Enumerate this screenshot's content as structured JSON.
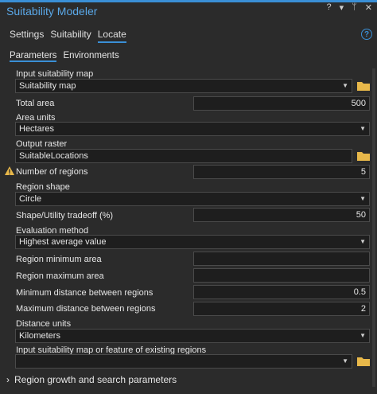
{
  "window": {
    "title": "Suitability Modeler",
    "controls": [
      "?",
      "▾",
      "ᛘ",
      "✕"
    ]
  },
  "tabs": [
    "Settings",
    "Suitability",
    "Locate"
  ],
  "subtabs": [
    "Parameters",
    "Environments"
  ],
  "help_symbol": "?",
  "params": {
    "input_suitability_map": {
      "label": "Input suitability map",
      "value": "Suitability map"
    },
    "total_area": {
      "label": "Total area",
      "value": "500"
    },
    "area_units": {
      "label": "Area units",
      "value": "Hectares"
    },
    "output_raster": {
      "label": "Output raster",
      "value": "SuitableLocations"
    },
    "number_of_regions": {
      "label": "Number of regions",
      "value": "5"
    },
    "region_shape": {
      "label": "Region shape",
      "value": "Circle"
    },
    "shape_tradeoff": {
      "label": "Shape/Utility tradeoff (%)",
      "value": "50"
    },
    "evaluation_method": {
      "label": "Evaluation method",
      "value": "Highest average value"
    },
    "region_min_area": {
      "label": "Region minimum area",
      "value": ""
    },
    "region_max_area": {
      "label": "Region maximum area",
      "value": ""
    },
    "min_distance": {
      "label": "Minimum distance between regions",
      "value": "0.5"
    },
    "max_distance": {
      "label": "Maximum distance between regions",
      "value": "2"
    },
    "distance_units": {
      "label": "Distance units",
      "value": "Kilometers"
    },
    "existing_regions": {
      "label": "Input suitability map or feature of existing regions",
      "value": ""
    }
  },
  "section": {
    "label": "Region growth and search parameters"
  },
  "colors": {
    "accent": "#3a8fd6",
    "background": "#2b2b2b",
    "field": "#1e1e1e",
    "folder": "#e8b84a",
    "warning": "#e8b84a"
  }
}
